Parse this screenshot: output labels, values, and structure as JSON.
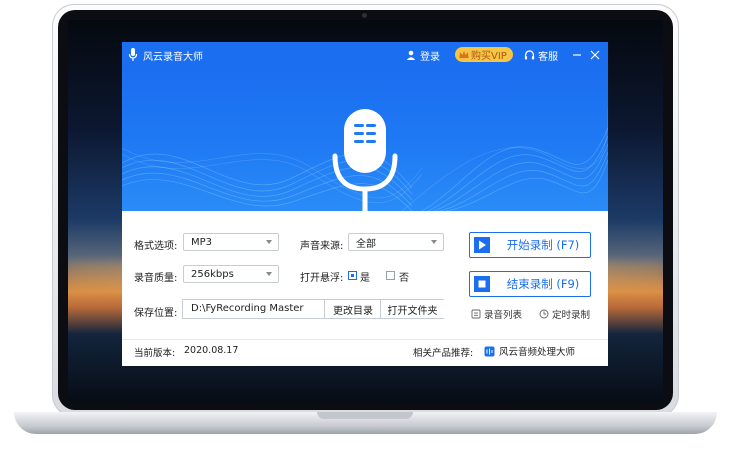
{
  "app": {
    "title": "风云录音大师",
    "login_label": "登录",
    "vip_label": "购买VIP",
    "service_label": "客服"
  },
  "settings": {
    "format_label": "格式选项:",
    "format_value": "MP3",
    "quality_label": "录音质量:",
    "quality_value": "256kbps",
    "source_label": "声音来源:",
    "source_value": "全部",
    "float_label": "打开悬浮:",
    "float_yes_label": "是",
    "float_no_label": "否",
    "save_label": "保存位置:",
    "save_path": "D:\\FyRecording Master",
    "change_dir_label": "更改目录",
    "open_folder_label": "打开文件夹"
  },
  "actions": {
    "start_label": "开始录制 (F7)",
    "stop_label": "结束录制 (F9)",
    "list_label": "录音列表",
    "schedule_label": "定时录制"
  },
  "footer": {
    "version_label": "当前版本:",
    "version_value": "2020.08.17",
    "related_label": "相关产品推荐:",
    "related_product": "风云音频处理大师"
  },
  "colors": {
    "accent": "#1b6ef0",
    "vip": "#f5c543"
  },
  "icons": [
    "mic-icon",
    "user-icon",
    "crown-icon",
    "headset-icon",
    "minimize-icon",
    "close-icon",
    "play-icon",
    "stop-icon",
    "list-icon",
    "clock-icon",
    "audio-logo-icon",
    "caret-down-icon"
  ]
}
